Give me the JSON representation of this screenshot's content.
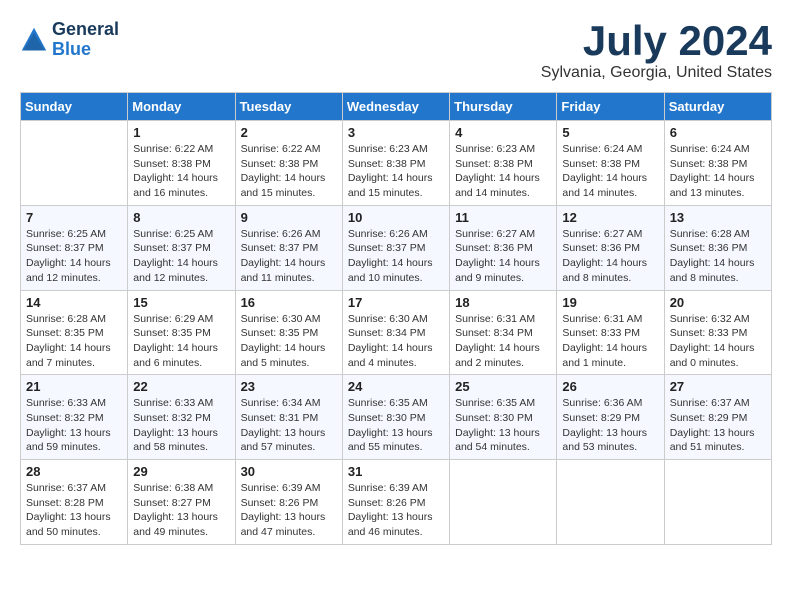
{
  "header": {
    "logo_line1": "General",
    "logo_line2": "Blue",
    "month_title": "July 2024",
    "location": "Sylvania, Georgia, United States"
  },
  "days_of_week": [
    "Sunday",
    "Monday",
    "Tuesday",
    "Wednesday",
    "Thursday",
    "Friday",
    "Saturday"
  ],
  "weeks": [
    [
      {
        "day": "",
        "content": ""
      },
      {
        "day": "1",
        "content": "Sunrise: 6:22 AM\nSunset: 8:38 PM\nDaylight: 14 hours\nand 16 minutes."
      },
      {
        "day": "2",
        "content": "Sunrise: 6:22 AM\nSunset: 8:38 PM\nDaylight: 14 hours\nand 15 minutes."
      },
      {
        "day": "3",
        "content": "Sunrise: 6:23 AM\nSunset: 8:38 PM\nDaylight: 14 hours\nand 15 minutes."
      },
      {
        "day": "4",
        "content": "Sunrise: 6:23 AM\nSunset: 8:38 PM\nDaylight: 14 hours\nand 14 minutes."
      },
      {
        "day": "5",
        "content": "Sunrise: 6:24 AM\nSunset: 8:38 PM\nDaylight: 14 hours\nand 14 minutes."
      },
      {
        "day": "6",
        "content": "Sunrise: 6:24 AM\nSunset: 8:38 PM\nDaylight: 14 hours\nand 13 minutes."
      }
    ],
    [
      {
        "day": "7",
        "content": "Sunrise: 6:25 AM\nSunset: 8:37 PM\nDaylight: 14 hours\nand 12 minutes."
      },
      {
        "day": "8",
        "content": "Sunrise: 6:25 AM\nSunset: 8:37 PM\nDaylight: 14 hours\nand 12 minutes."
      },
      {
        "day": "9",
        "content": "Sunrise: 6:26 AM\nSunset: 8:37 PM\nDaylight: 14 hours\nand 11 minutes."
      },
      {
        "day": "10",
        "content": "Sunrise: 6:26 AM\nSunset: 8:37 PM\nDaylight: 14 hours\nand 10 minutes."
      },
      {
        "day": "11",
        "content": "Sunrise: 6:27 AM\nSunset: 8:36 PM\nDaylight: 14 hours\nand 9 minutes."
      },
      {
        "day": "12",
        "content": "Sunrise: 6:27 AM\nSunset: 8:36 PM\nDaylight: 14 hours\nand 8 minutes."
      },
      {
        "day": "13",
        "content": "Sunrise: 6:28 AM\nSunset: 8:36 PM\nDaylight: 14 hours\nand 8 minutes."
      }
    ],
    [
      {
        "day": "14",
        "content": "Sunrise: 6:28 AM\nSunset: 8:35 PM\nDaylight: 14 hours\nand 7 minutes."
      },
      {
        "day": "15",
        "content": "Sunrise: 6:29 AM\nSunset: 8:35 PM\nDaylight: 14 hours\nand 6 minutes."
      },
      {
        "day": "16",
        "content": "Sunrise: 6:30 AM\nSunset: 8:35 PM\nDaylight: 14 hours\nand 5 minutes."
      },
      {
        "day": "17",
        "content": "Sunrise: 6:30 AM\nSunset: 8:34 PM\nDaylight: 14 hours\nand 4 minutes."
      },
      {
        "day": "18",
        "content": "Sunrise: 6:31 AM\nSunset: 8:34 PM\nDaylight: 14 hours\nand 2 minutes."
      },
      {
        "day": "19",
        "content": "Sunrise: 6:31 AM\nSunset: 8:33 PM\nDaylight: 14 hours\nand 1 minute."
      },
      {
        "day": "20",
        "content": "Sunrise: 6:32 AM\nSunset: 8:33 PM\nDaylight: 14 hours\nand 0 minutes."
      }
    ],
    [
      {
        "day": "21",
        "content": "Sunrise: 6:33 AM\nSunset: 8:32 PM\nDaylight: 13 hours\nand 59 minutes."
      },
      {
        "day": "22",
        "content": "Sunrise: 6:33 AM\nSunset: 8:32 PM\nDaylight: 13 hours\nand 58 minutes."
      },
      {
        "day": "23",
        "content": "Sunrise: 6:34 AM\nSunset: 8:31 PM\nDaylight: 13 hours\nand 57 minutes."
      },
      {
        "day": "24",
        "content": "Sunrise: 6:35 AM\nSunset: 8:30 PM\nDaylight: 13 hours\nand 55 minutes."
      },
      {
        "day": "25",
        "content": "Sunrise: 6:35 AM\nSunset: 8:30 PM\nDaylight: 13 hours\nand 54 minutes."
      },
      {
        "day": "26",
        "content": "Sunrise: 6:36 AM\nSunset: 8:29 PM\nDaylight: 13 hours\nand 53 minutes."
      },
      {
        "day": "27",
        "content": "Sunrise: 6:37 AM\nSunset: 8:29 PM\nDaylight: 13 hours\nand 51 minutes."
      }
    ],
    [
      {
        "day": "28",
        "content": "Sunrise: 6:37 AM\nSunset: 8:28 PM\nDaylight: 13 hours\nand 50 minutes."
      },
      {
        "day": "29",
        "content": "Sunrise: 6:38 AM\nSunset: 8:27 PM\nDaylight: 13 hours\nand 49 minutes."
      },
      {
        "day": "30",
        "content": "Sunrise: 6:39 AM\nSunset: 8:26 PM\nDaylight: 13 hours\nand 47 minutes."
      },
      {
        "day": "31",
        "content": "Sunrise: 6:39 AM\nSunset: 8:26 PM\nDaylight: 13 hours\nand 46 minutes."
      },
      {
        "day": "",
        "content": ""
      },
      {
        "day": "",
        "content": ""
      },
      {
        "day": "",
        "content": ""
      }
    ]
  ]
}
